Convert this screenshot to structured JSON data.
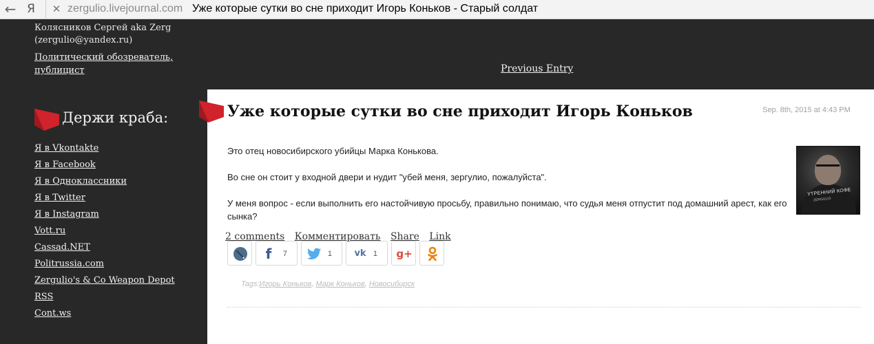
{
  "browser": {
    "back_icon": "back-arrow-icon",
    "logo_glyph": "Я",
    "close_glyph": "✕",
    "domain": "zergulio.livejournal.com",
    "title": "Уже которые сутки во сне приходит Игорь Коньков - Старый солдат"
  },
  "sidebar": {
    "author_line1": "Колясников Сергей aka Zerg",
    "author_line2": "(zergulio@yandex.ru)",
    "role": "Политический обозреватель, публицист",
    "heading": "Держи краба:",
    "links": [
      "Я в Vkontakte",
      "Я в Facebook",
      "Я в Одноклассники",
      "Я в Twitter",
      "Я в Instagram",
      "Vott.ru",
      "Cassad.NET",
      "Politrussia.com",
      "Zergulio's & Co Weapon Depot",
      "RSS",
      "Cont.ws"
    ]
  },
  "nav": {
    "previous_entry": "Previous Entry"
  },
  "post": {
    "title": "Уже которые сутки во сне приходит Игорь Коньков",
    "date": "Sep. 8th, 2015 at 4:43 PM",
    "paragraphs": [
      "Это отец новосибирского убийцы Марка Конькова.",
      "Во сне он стоит у входной двери и нудит \"убей меня, зергулио, пожалуйста\".",
      "У меня вопрос - если выполнить его настойчивую просьбу, правильно понимаю, что судья меня отпустит под домашний арест, как его сынка?"
    ],
    "avatar_caption": "УТРЕННИЙ КОФЕ",
    "avatar_subcaption": "ZERGULIO",
    "share": {
      "livejournal": {
        "icon": "livejournal-icon"
      },
      "facebook": {
        "icon": "facebook-icon",
        "glyph": "f",
        "count": "7"
      },
      "twitter": {
        "icon": "twitter-icon",
        "count": "1"
      },
      "vkontakte": {
        "icon": "vk-icon",
        "glyph": "vk",
        "count": "1"
      },
      "googleplus": {
        "icon": "google-plus-icon",
        "glyph": "g+"
      },
      "odnoklassniki": {
        "icon": "odnoklassniki-icon"
      }
    },
    "tags_label": "Tags:",
    "tags": [
      "Игорь Коньков",
      "Марк Коньков",
      "Новосибирск"
    ],
    "footer_links": {
      "comments": "2 comments",
      "comment": "Комментировать",
      "share": "Share",
      "link": "Link"
    }
  },
  "colors": {
    "background": "#282828",
    "panel": "#ffffff",
    "accent_red": "#d0232b",
    "facebook": "#3b5998",
    "twitter": "#55acee",
    "vk": "#4c75a3",
    "googleplus": "#dd4b39",
    "odnoklassniki": "#ee8208"
  }
}
